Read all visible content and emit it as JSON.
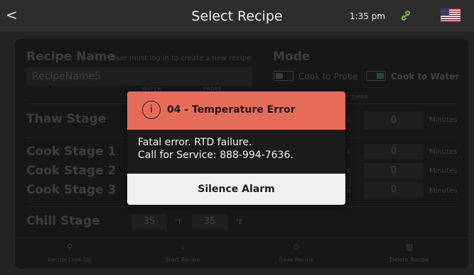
{
  "header": {
    "back_glyph": "<",
    "title": "Select Recipe",
    "time": "1:35 pm",
    "connection_icon": "link-icon",
    "language_flag": "us-flag"
  },
  "form": {
    "recipe_name_label": "Recipe Name",
    "recipe_name_hint": "User must log in to create a new recipe",
    "recipe_name_value": "RecipeName5",
    "mode_label": "Mode",
    "mode_options": [
      {
        "label": "Cook to Probe",
        "selected": false
      },
      {
        "label": "Cook to Water",
        "selected": true
      }
    ],
    "column_water": "WATER",
    "column_probe": "PROBE",
    "column_timer": "K TIMER",
    "stages": [
      {
        "name": "Thaw Stage",
        "timer": "0",
        "unit": "Minutes",
        "suffix": "s"
      },
      {
        "name": "Cook Stage 1",
        "timer": "0",
        "unit": "Minutes",
        "suffix": "s"
      },
      {
        "name": "Cook Stage 2",
        "timer": "0",
        "unit": "Minutes",
        "suffix": "s"
      },
      {
        "name": "Cook Stage 3",
        "timer": "0",
        "unit": "Minutes",
        "suffix": "s"
      }
    ],
    "chill": {
      "name": "Chill Stage",
      "water": "35",
      "water_unit": "°F",
      "probe": "35",
      "probe_unit": "°F"
    }
  },
  "bottom_bar": [
    {
      "icon": "search-icon",
      "glyph": "⚲",
      "label": "Recipe Look-Up"
    },
    {
      "icon": "download-icon",
      "glyph": "⤓",
      "label": "Start Recipe"
    },
    {
      "icon": "check-circle-icon",
      "glyph": "⊙",
      "label": "Save Recipe"
    },
    {
      "icon": "trash-icon",
      "glyph": "▥",
      "label": "Delete Recipe"
    }
  ],
  "dialog": {
    "icon": "info-icon",
    "icon_glyph": "i",
    "title": "04 - Temperature Error",
    "body_line1": "Fatal error. RTD failure.",
    "body_line2": "Call for Service: 888-994-7636.",
    "button_label": "Silence Alarm",
    "header_color": "#e66c5a"
  }
}
